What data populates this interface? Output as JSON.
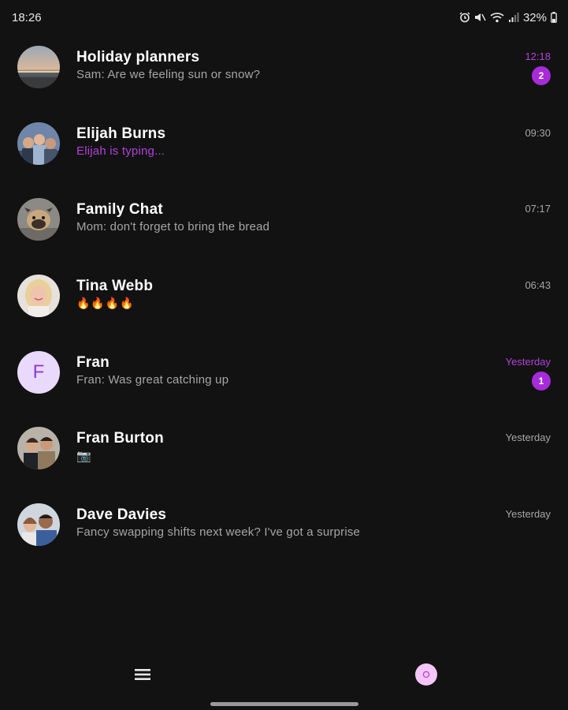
{
  "status_bar": {
    "time": "18:26",
    "battery": "32%",
    "icons": [
      "alarm-icon",
      "mute-icon",
      "wifi-icon",
      "signal-icon",
      "battery-icon"
    ]
  },
  "chats": [
    {
      "name": "Holiday planners",
      "preview": "Sam: Are we feeling sun or snow?",
      "time": "12:18",
      "unread": "2",
      "avatar": "beach-photo"
    },
    {
      "name": "Elijah Burns",
      "preview": "Elijah is typing...",
      "time": "09:30",
      "avatar": "group-selfie-photo"
    },
    {
      "name": "Family Chat",
      "preview": "Mom: don't forget to bring the bread",
      "time": "07:17",
      "avatar": "dog-photo"
    },
    {
      "name": "Tina Webb",
      "preview": "🔥🔥🔥🔥",
      "time": "06:43",
      "avatar": "woman-photo"
    },
    {
      "name": "Fran",
      "preview": "Fran: Was great catching up",
      "time": "Yesterday",
      "unread": "1",
      "avatar_letter": "F"
    },
    {
      "name": "Fran Burton",
      "preview": "📷",
      "time": "Yesterday",
      "avatar": "couple-photo"
    },
    {
      "name": "Dave Davies",
      "preview": "Fancy swapping shifts next week? I've got a surprise",
      "time": "Yesterday",
      "avatar": "man-selfie-photo"
    }
  ],
  "bottom_bar": {
    "menu_icon": "hamburger-menu-icon",
    "compose_icon": "compose-icon"
  },
  "colors": {
    "background": "#121212",
    "accent": "#a62bd9",
    "accent_text": "#b043d8",
    "secondary_text": "#a6a6a6",
    "compose_button": "#f5c5f7"
  }
}
